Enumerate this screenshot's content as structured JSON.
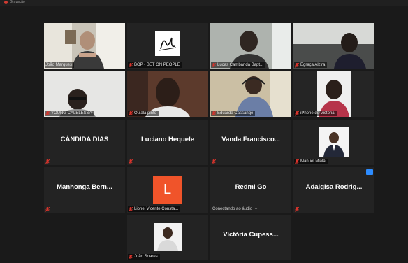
{
  "window": {
    "title": "Gravação"
  },
  "colors": {
    "active_speaker": "#b8d84a",
    "tile_bg": "#232323",
    "mute_icon": "#d8342c",
    "letter_avatar": "#f0542a",
    "badge": "#2d8cff"
  },
  "tiles": [
    {
      "label": "João Marques"
    },
    {
      "label": "BOP - BET ON PEOPLE"
    },
    {
      "label": "Lucas Cambanda Bapt..."
    },
    {
      "label": "Egraça Alzira"
    },
    {
      "label": "YOUNG CALELESSA"
    },
    {
      "label": "Quiala pinto"
    },
    {
      "label": "Eduarda Cassange"
    },
    {
      "label": "iPhone de Victoria"
    },
    {
      "name": "CÂNDIDA DIAS"
    },
    {
      "name": "Luciano Hequele"
    },
    {
      "name": "Vanda.Francisco..."
    },
    {
      "label": "Manuel Miala"
    },
    {
      "name": "Manhonga Bern..."
    },
    {
      "label": "Lionel Vicente Consta...",
      "initial": "L"
    },
    {
      "name": "Redmi Go",
      "status": "Conectando ao áudio ···"
    },
    {
      "name": "Adalgisa Rodrig..."
    },
    {
      "label": "João Soares"
    },
    {
      "name": "Victória Cupess..."
    }
  ]
}
